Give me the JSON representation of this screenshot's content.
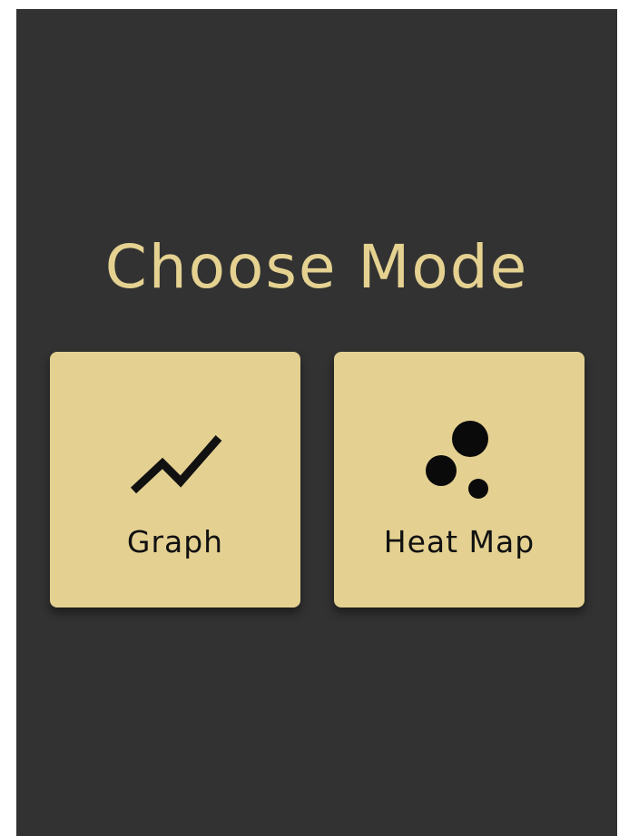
{
  "screen": {
    "title": "Choose Mode",
    "colors": {
      "background": "#323232",
      "accent": "#E4D192",
      "title_text": "#E5D291",
      "card_text": "#111111"
    }
  },
  "modes": [
    {
      "label": "Graph",
      "icon": "trend-line-icon"
    },
    {
      "label": "Heat Map",
      "icon": "bubbles-icon"
    }
  ]
}
